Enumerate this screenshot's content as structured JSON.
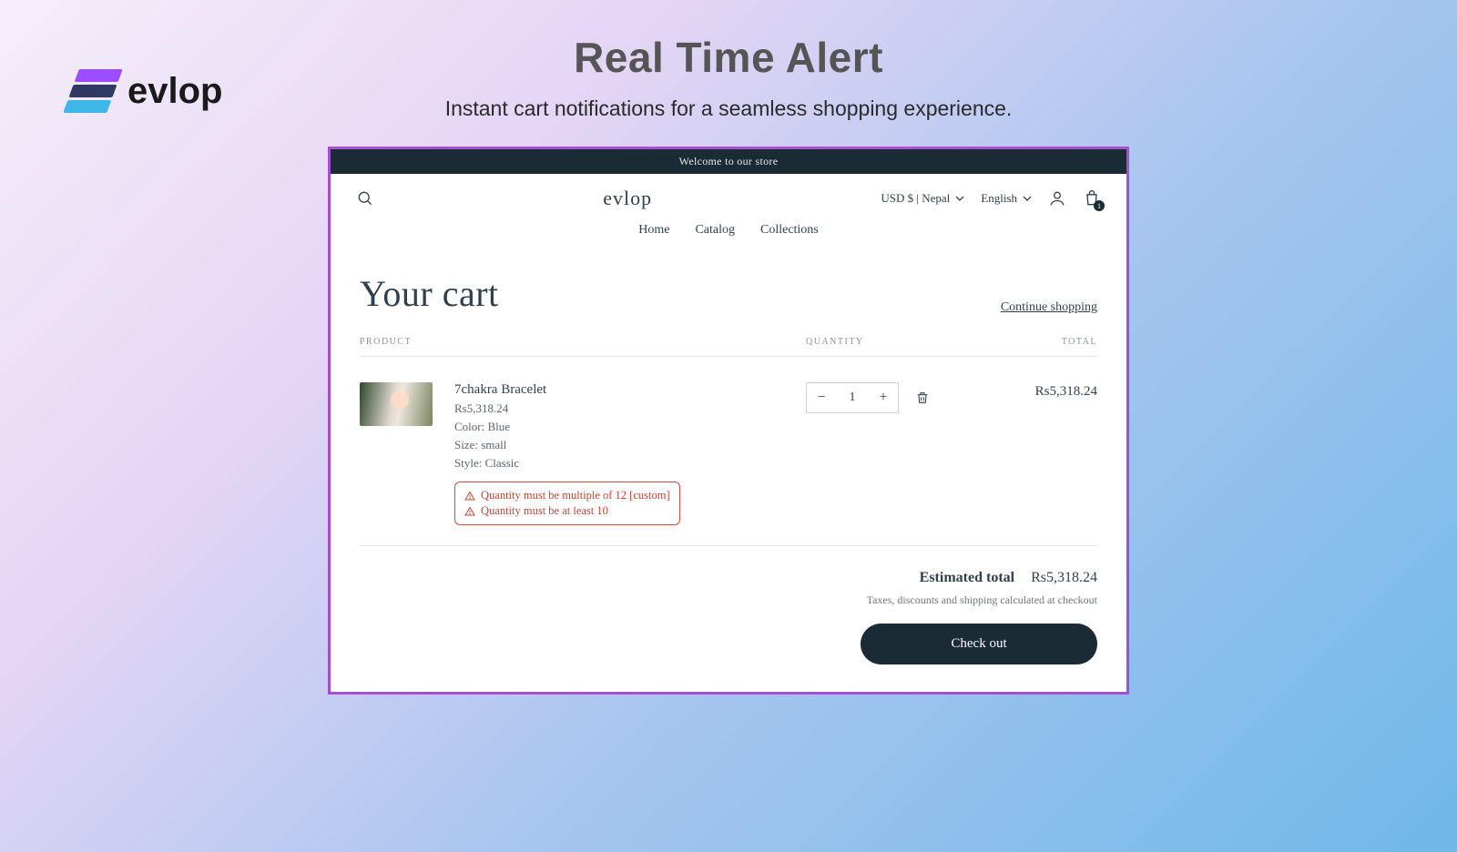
{
  "hero": {
    "brand": "evlop",
    "title": "Real Time Alert",
    "subtitle": "Instant cart notifications for a seamless shopping experience."
  },
  "store": {
    "announcement": "Welcome to our store",
    "logo": "evlop",
    "currency_selector": "USD $ | Nepal",
    "language_selector": "English",
    "cart_count": "1",
    "nav": {
      "home": "Home",
      "catalog": "Catalog",
      "collections": "Collections"
    }
  },
  "cart": {
    "title": "Your cart",
    "continue": "Continue shopping",
    "columns": {
      "product": "PRODUCT",
      "quantity": "QUANTITY",
      "total": "TOTAL"
    },
    "item": {
      "name": "7chakra Bracelet",
      "price": "Rs5,318.24",
      "color": "Color: Blue",
      "size": "Size: small",
      "style": "Style: Classic",
      "qty": "1",
      "line_total": "Rs5,318.24",
      "alert1": "Quantity must be multiple of 12 [custom]",
      "alert2": "Quantity must be at least 10"
    },
    "summary": {
      "est_label": "Estimated total",
      "est_value": "Rs5,318.24",
      "tax_note": "Taxes, discounts and shipping calculated at checkout",
      "checkout": "Check out"
    }
  }
}
